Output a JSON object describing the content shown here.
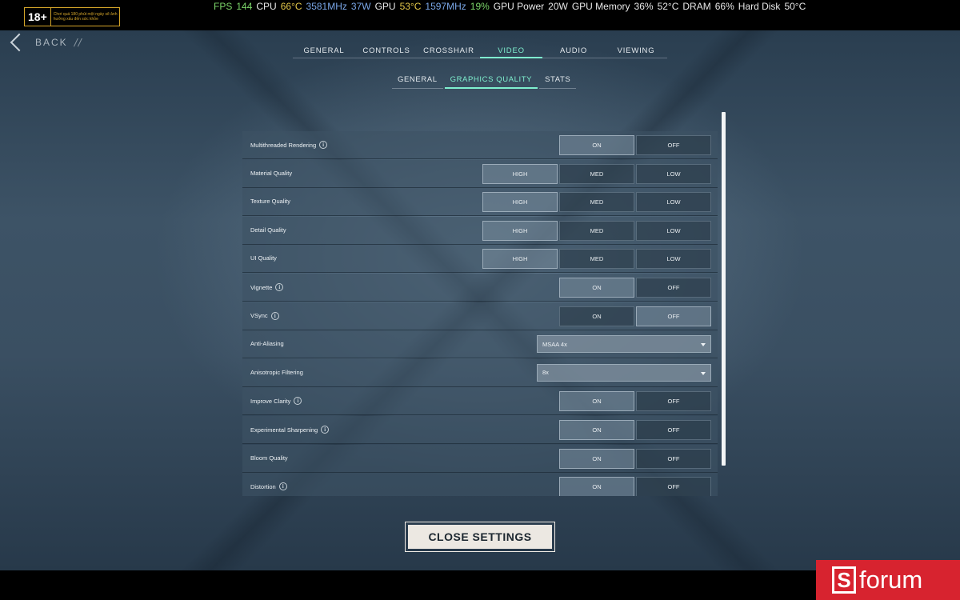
{
  "overlay": {
    "age_rating": "18+",
    "age_warning": "Chơi quá 180 phút một ngày sẽ ảnh hưởng xấu đến sức khỏe",
    "stats": [
      {
        "text": "FPS",
        "color": "#7cd66a"
      },
      {
        "text": "144",
        "color": "#7cd66a"
      },
      {
        "text": "CPU",
        "color": "#e8e8e8"
      },
      {
        "text": "66°C",
        "color": "#e6c94a"
      },
      {
        "text": "3581MHz",
        "color": "#7aa7e8"
      },
      {
        "text": "37W",
        "color": "#7aa7e8"
      },
      {
        "text": "GPU",
        "color": "#e8e8e8"
      },
      {
        "text": "53°C",
        "color": "#e6c94a"
      },
      {
        "text": "1597MHz",
        "color": "#7aa7e8"
      },
      {
        "text": "19%",
        "color": "#7cd66a"
      },
      {
        "text": "GPU Power",
        "color": "#e8e8e8"
      },
      {
        "text": "20W",
        "color": "#e8e8e8"
      },
      {
        "text": "GPU Memory",
        "color": "#e8e8e8"
      },
      {
        "text": "36%",
        "color": "#e8e8e8"
      },
      {
        "text": "52°C",
        "color": "#e8e8e8"
      },
      {
        "text": "DRAM",
        "color": "#e8e8e8"
      },
      {
        "text": "66%",
        "color": "#e8e8e8"
      },
      {
        "text": "Hard Disk",
        "color": "#e8e8e8"
      },
      {
        "text": "50°C",
        "color": "#e8e8e8"
      }
    ]
  },
  "nav": {
    "back_label": "BACK",
    "back_suffix": "//"
  },
  "tabs": [
    {
      "label": "GENERAL",
      "active": false
    },
    {
      "label": "CONTROLS",
      "active": false
    },
    {
      "label": "CROSSHAIR",
      "active": false
    },
    {
      "label": "VIDEO",
      "active": true
    },
    {
      "label": "AUDIO",
      "active": false
    },
    {
      "label": "VIEWING",
      "active": false
    }
  ],
  "subtabs": [
    {
      "label": "GENERAL",
      "active": false
    },
    {
      "label": "GRAPHICS QUALITY",
      "active": true
    },
    {
      "label": "STATS",
      "active": false
    }
  ],
  "settings": [
    {
      "label": "Multithreaded Rendering",
      "info": true,
      "type": "toggle",
      "options": [
        "ON",
        "OFF"
      ],
      "selected": "ON"
    },
    {
      "label": "Material Quality",
      "info": false,
      "type": "quality",
      "options": [
        "HIGH",
        "MED",
        "LOW"
      ],
      "selected": "HIGH"
    },
    {
      "label": "Texture Quality",
      "info": false,
      "type": "quality",
      "options": [
        "HIGH",
        "MED",
        "LOW"
      ],
      "selected": "HIGH"
    },
    {
      "label": "Detail Quality",
      "info": false,
      "type": "quality",
      "options": [
        "HIGH",
        "MED",
        "LOW"
      ],
      "selected": "HIGH"
    },
    {
      "label": "UI Quality",
      "info": false,
      "type": "quality",
      "options": [
        "HIGH",
        "MED",
        "LOW"
      ],
      "selected": "HIGH"
    },
    {
      "label": "Vignette",
      "info": true,
      "type": "toggle",
      "options": [
        "ON",
        "OFF"
      ],
      "selected": "ON"
    },
    {
      "label": "VSync",
      "info": true,
      "type": "toggle",
      "options": [
        "ON",
        "OFF"
      ],
      "selected": "OFF"
    },
    {
      "label": "Anti-Aliasing",
      "info": false,
      "type": "dropdown",
      "value": "MSAA 4x"
    },
    {
      "label": "Anisotropic Filtering",
      "info": false,
      "type": "dropdown",
      "value": "8x"
    },
    {
      "label": "Improve Clarity",
      "info": true,
      "type": "toggle",
      "options": [
        "ON",
        "OFF"
      ],
      "selected": "ON"
    },
    {
      "label": "Experimental Sharpening",
      "info": true,
      "type": "toggle",
      "options": [
        "ON",
        "OFF"
      ],
      "selected": "ON"
    },
    {
      "label": "Bloom Quality",
      "info": false,
      "type": "toggle",
      "options": [
        "ON",
        "OFF"
      ],
      "selected": "ON"
    },
    {
      "label": "Distortion",
      "info": true,
      "type": "toggle",
      "options": [
        "ON",
        "OFF"
      ],
      "selected": "ON"
    }
  ],
  "footer": {
    "close_label": "CLOSE SETTINGS"
  },
  "watermark": {
    "logo_letter": "S",
    "logo_text": "forum"
  }
}
